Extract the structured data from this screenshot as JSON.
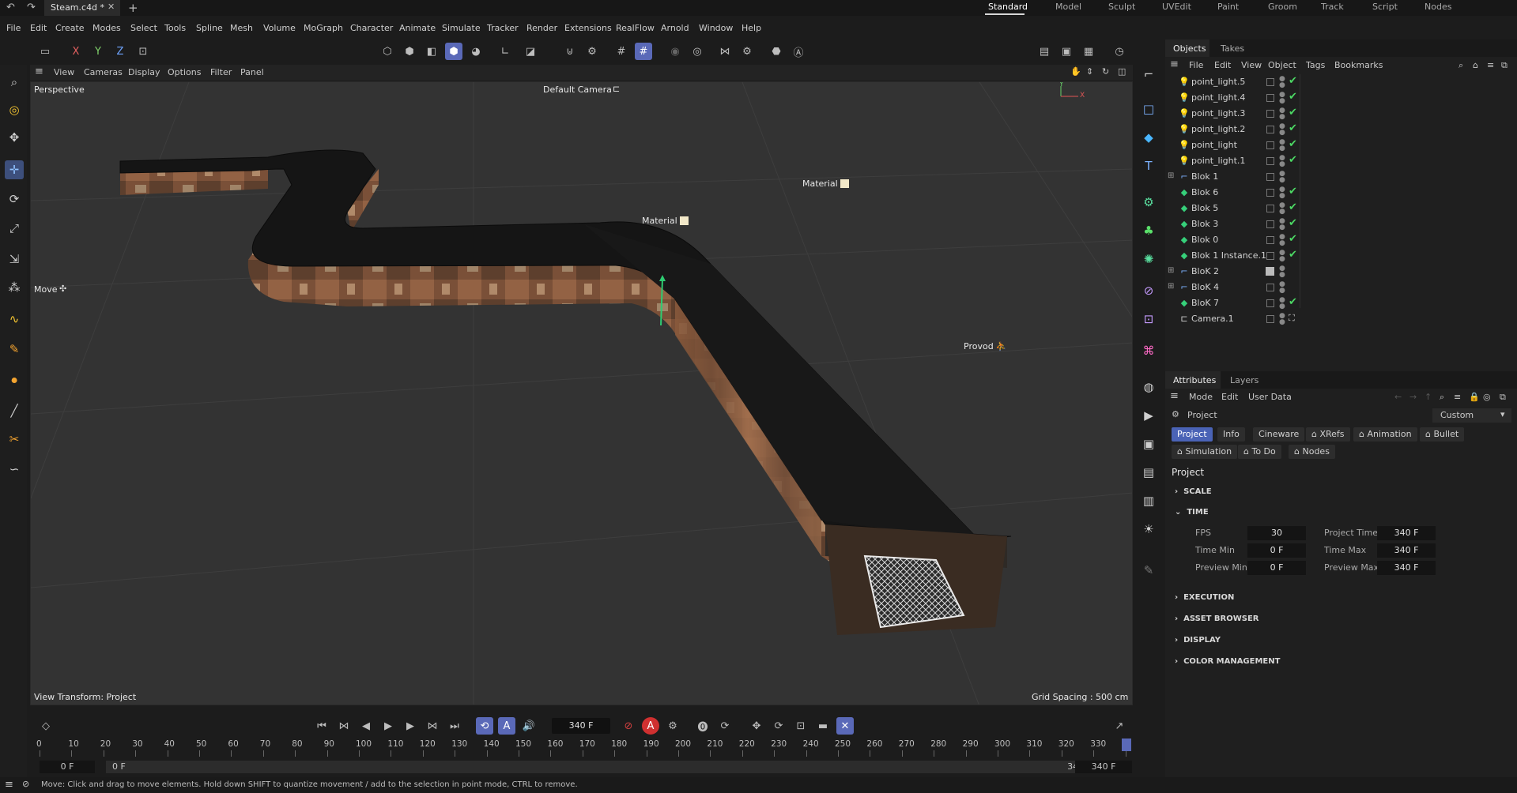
{
  "titlebar": {
    "tab_title": "Steam.c4d *",
    "layouts": [
      "Standard",
      "Model",
      "Sculpt",
      "UVEdit",
      "Paint",
      "Groom",
      "Track",
      "Script",
      "Nodes"
    ],
    "active_layout": "Standard"
  },
  "menubar": {
    "items": [
      "File",
      "Edit",
      "Create",
      "Modes",
      "Select",
      "Tools",
      "Spline",
      "Mesh",
      "Volume",
      "MoGraph",
      "Character",
      "Animate",
      "Simulate",
      "Tracker",
      "Render",
      "Extensions",
      "RealFlow",
      "Arnold",
      "Window",
      "Help"
    ]
  },
  "toolbar": {
    "axis_x": "X",
    "axis_y": "Y",
    "axis_z": "Z"
  },
  "viewport": {
    "menu": [
      "View",
      "Cameras",
      "Display",
      "Options",
      "Filter",
      "Panel"
    ],
    "perspective_label": "Perspective",
    "camera_label": "Default Camera",
    "move_label": "Move",
    "view_transform": "View Transform: Project",
    "grid_spacing": "Grid Spacing : 500 cm",
    "material_tag_1": "Material",
    "material_tag_2": "Material",
    "provod_tag": "Provod",
    "axis_y": "Y",
    "axis_x": "X"
  },
  "objects_panel": {
    "tabs": [
      "Objects",
      "Takes"
    ],
    "active_tab": "Objects",
    "menu": [
      "File",
      "Edit",
      "View",
      "Object",
      "Tags",
      "Bookmarks"
    ],
    "rows": [
      {
        "name": "point_light.5",
        "type": "light",
        "checked": true
      },
      {
        "name": "point_light.4",
        "type": "light",
        "checked": true
      },
      {
        "name": "point_light.3",
        "type": "light",
        "checked": true
      },
      {
        "name": "point_light.2",
        "type": "light",
        "checked": true
      },
      {
        "name": "point_light",
        "type": "light",
        "checked": true
      },
      {
        "name": "point_light.1",
        "type": "light",
        "checked": true
      },
      {
        "name": "Blok 1",
        "type": "null",
        "checked": false,
        "expandable": true
      },
      {
        "name": "Blok  6",
        "type": "mesh",
        "checked": true
      },
      {
        "name": "Blok  5",
        "type": "mesh",
        "checked": true
      },
      {
        "name": "Blok 3",
        "type": "mesh",
        "checked": true
      },
      {
        "name": "Blok 0",
        "type": "mesh",
        "checked": true
      },
      {
        "name": "Blok 1 Instance.1",
        "type": "mesh",
        "checked": true
      },
      {
        "name": "BloK 2",
        "type": "null",
        "checked": false,
        "expandable": true,
        "tag": true
      },
      {
        "name": "BloK  4",
        "type": "null",
        "checked": false,
        "expandable": true
      },
      {
        "name": "BloK 7",
        "type": "mesh",
        "checked": true
      },
      {
        "name": "Camera.1",
        "type": "camera",
        "checked": false
      }
    ]
  },
  "attributes": {
    "tabs": [
      "Attributes",
      "Layers"
    ],
    "active_tab": "Attributes",
    "menu": [
      "Mode",
      "Edit",
      "User Data"
    ],
    "breadcrumb": "Project",
    "preset": "Custom",
    "chips_row1": [
      "Project",
      "Info",
      "Cineware",
      "XRefs",
      "Animation",
      "Bullet"
    ],
    "chips_row2": [
      "Simulation",
      "To Do",
      "Nodes"
    ],
    "active_chip": "Project",
    "section_title": "Project",
    "sections": {
      "scale": "SCALE",
      "time": "TIME",
      "execution": "EXECUTION",
      "asset_browser": "ASSET BROWSER",
      "display": "DISPLAY",
      "color_management": "COLOR MANAGEMENT"
    },
    "fields": {
      "fps_label": "FPS",
      "fps": "30",
      "project_time_label": "Project Time",
      "project_time": "340 F",
      "time_min_label": "Time Min",
      "time_min": "0 F",
      "time_max_label": "Time Max",
      "time_max": "340 F",
      "preview_min_label": "Preview Min",
      "preview_min": "0 F",
      "preview_max_label": "Preview Max",
      "preview_max": "340 F"
    }
  },
  "timeline": {
    "current_frame": "340 F",
    "ticks": [
      "0",
      "10",
      "20",
      "30",
      "40",
      "50",
      "60",
      "70",
      "80",
      "90",
      "100",
      "110",
      "120",
      "130",
      "140",
      "150",
      "160",
      "170",
      "180",
      "190",
      "200",
      "210",
      "220",
      "230",
      "240",
      "250",
      "260",
      "270",
      "280",
      "290",
      "300",
      "310",
      "320",
      "330",
      "3"
    ],
    "range_start": "0 F",
    "range_start_2": "0 F",
    "range_end": "340 F",
    "range_end_2": "340 F"
  },
  "status": {
    "message": "Move: Click and drag to move elements. Hold down SHIFT to quantize movement / add to the selection in point mode, CTRL to remove."
  },
  "colors": {
    "accent": "#5a69b8",
    "check_green": "#4cd964",
    "viewport_bg": "#333333"
  }
}
